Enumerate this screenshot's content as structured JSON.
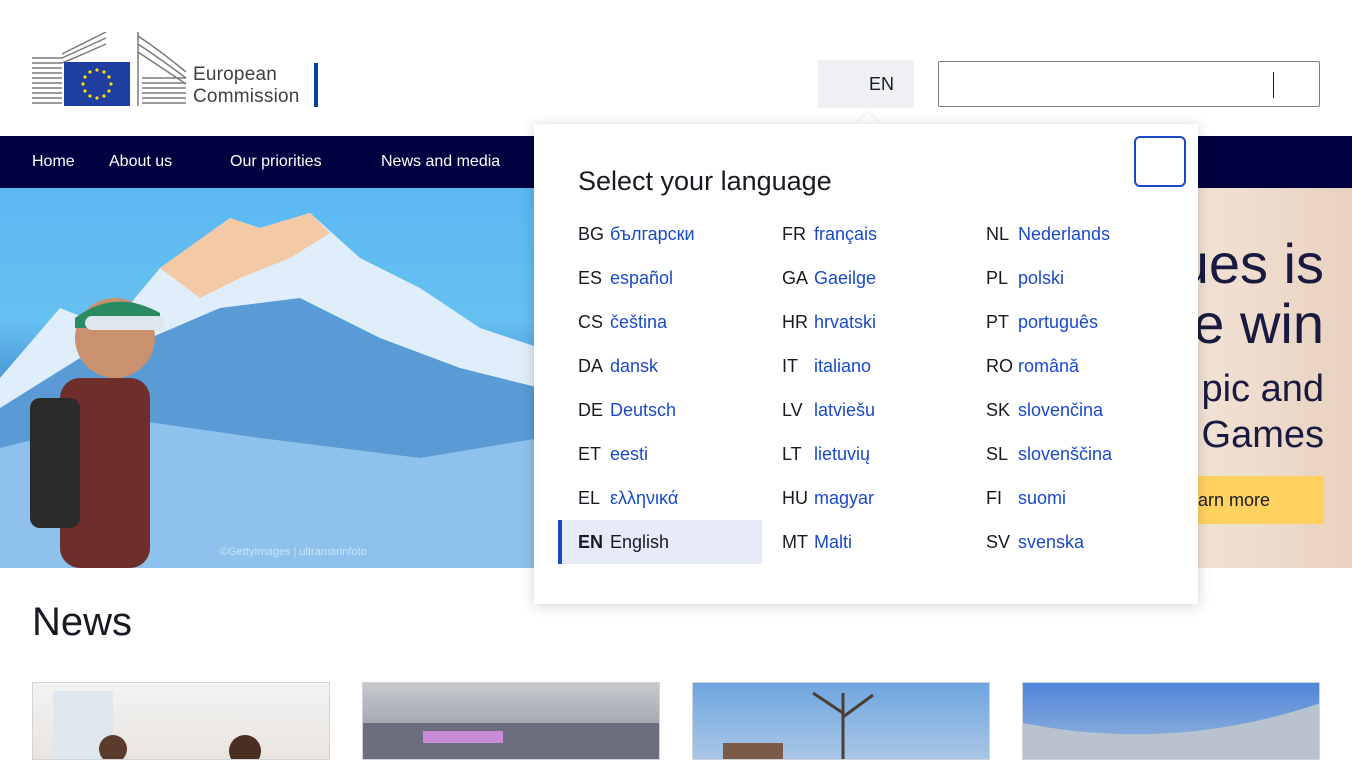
{
  "header": {
    "logo_line1": "European",
    "logo_line2": "Commission",
    "lang_code": "EN",
    "search_value": ""
  },
  "nav": {
    "items": [
      "Home",
      "About us",
      "Our priorities",
      "News and media"
    ]
  },
  "hero": {
    "title_line1": "ues is",
    "title_line2": "e win",
    "sub_line1": "pic and",
    "sub_line2": "Games",
    "cta": "arn more",
    "credit": "©GettyImages | ultramarinfoto"
  },
  "news": {
    "title": "News"
  },
  "language_panel": {
    "title": "Select your language",
    "columns": [
      [
        {
          "code": "BG",
          "name": "български"
        },
        {
          "code": "ES",
          "name": "español"
        },
        {
          "code": "CS",
          "name": "čeština"
        },
        {
          "code": "DA",
          "name": "dansk"
        },
        {
          "code": "DE",
          "name": "Deutsch"
        },
        {
          "code": "ET",
          "name": "eesti"
        },
        {
          "code": "EL",
          "name": "ελληνικά"
        },
        {
          "code": "EN",
          "name": "English"
        }
      ],
      [
        {
          "code": "FR",
          "name": "français"
        },
        {
          "code": "GA",
          "name": "Gaeilge"
        },
        {
          "code": "HR",
          "name": "hrvatski"
        },
        {
          "code": "IT",
          "name": "italiano"
        },
        {
          "code": "LV",
          "name": "latviešu"
        },
        {
          "code": "LT",
          "name": "lietuvių"
        },
        {
          "code": "HU",
          "name": "magyar"
        },
        {
          "code": "MT",
          "name": "Malti"
        }
      ],
      [
        {
          "code": "NL",
          "name": "Nederlands"
        },
        {
          "code": "PL",
          "name": "polski"
        },
        {
          "code": "PT",
          "name": "português"
        },
        {
          "code": "RO",
          "name": "română"
        },
        {
          "code": "SK",
          "name": "slovenčina"
        },
        {
          "code": "SL",
          "name": "slovenščina"
        },
        {
          "code": "FI",
          "name": "suomi"
        },
        {
          "code": "SV",
          "name": "svenska"
        }
      ]
    ],
    "selected": "EN"
  },
  "colors": {
    "nav_bg": "#000040",
    "link": "#1a4ac8",
    "cta": "#ffd25f",
    "selected_bg": "#e6ebf7"
  },
  "icons": [
    "globe-icon",
    "search-icon",
    "close-icon",
    "eu-flag-icon"
  ]
}
